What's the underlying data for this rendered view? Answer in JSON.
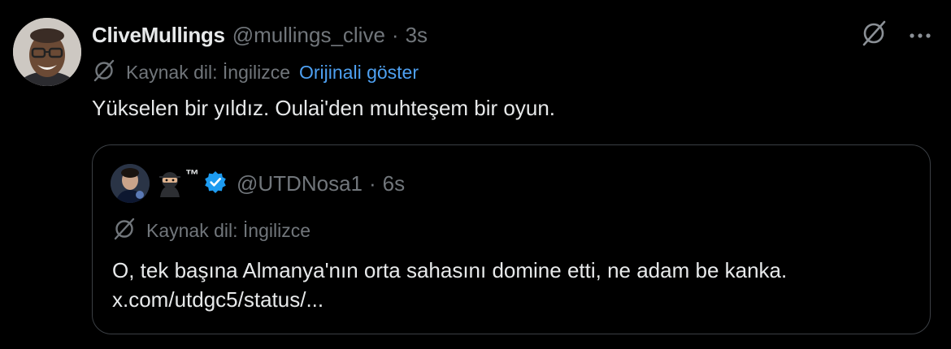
{
  "tweet": {
    "author_name": "CliveMullings",
    "author_handle": "@mullings_clive",
    "separator": "·",
    "time": "3s",
    "translation": {
      "source_label": "Kaynak dil: İngilizce",
      "show_original_label": "Orijinali göster"
    },
    "text": "Yükselen bir yıldız. Oulai'den muhteşem bir oyun.",
    "actions": {
      "more_label": "···"
    }
  },
  "quote": {
    "tm_label": "™",
    "author_handle": "@UTDNosa1",
    "separator": "·",
    "time": "6s",
    "translation": {
      "source_label": "Kaynak dil: İngilizce"
    },
    "text_line1": "O, tek başına Almanya'nın orta sahasını domine etti, ne adam be kanka.",
    "text_line2": "x.com/utdgc5/status/..."
  },
  "colors": {
    "background": "#000000",
    "text": "#e7e9ea",
    "muted": "#71767b",
    "link": "#4ea0f1",
    "verified": "#1d9bf0",
    "border": "#3b3f44"
  },
  "icons": [
    "translate-icon",
    "more-icon",
    "verified-badge-icon",
    "ninja-emoji-icon"
  ]
}
